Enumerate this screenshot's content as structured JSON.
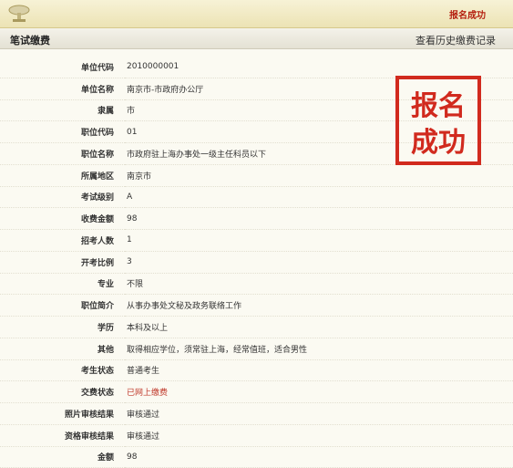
{
  "header": {
    "status_title": "报名成功"
  },
  "section": {
    "title": "笔试缴费",
    "history_link": "查看历史缴费记录"
  },
  "stamp": {
    "text": "报名成功",
    "color": "#d12a1e"
  },
  "fields": [
    {
      "label": "单位代码",
      "value": "2010000001"
    },
    {
      "label": "单位名称",
      "value": "南京市-市政府办公厅"
    },
    {
      "label": "隶属",
      "value": "市"
    },
    {
      "label": "职位代码",
      "value": "01"
    },
    {
      "label": "职位名称",
      "value": "市政府驻上海办事处一级主任科员以下"
    },
    {
      "label": "所属地区",
      "value": "南京市"
    },
    {
      "label": "考试级别",
      "value": "A"
    },
    {
      "label": "收费金额",
      "value": "98"
    },
    {
      "label": "招考人数",
      "value": "1"
    },
    {
      "label": "开考比例",
      "value": "3"
    },
    {
      "label": "专业",
      "value": "不限"
    },
    {
      "label": "职位简介",
      "value": "从事办事处文秘及政务联络工作"
    },
    {
      "label": "学历",
      "value": "本科及以上"
    },
    {
      "label": "其他",
      "value": "取得相应学位，须常驻上海，经常值班，适合男性"
    },
    {
      "label": "考生状态",
      "value": "普通考生"
    },
    {
      "label": "交费状态",
      "value": "已网上缴费",
      "color": "#c0392b"
    },
    {
      "label": "照片审核结果",
      "value": "审核通过"
    },
    {
      "label": "资格审核结果",
      "value": "审核通过"
    },
    {
      "label": "金额",
      "value": "98"
    }
  ]
}
